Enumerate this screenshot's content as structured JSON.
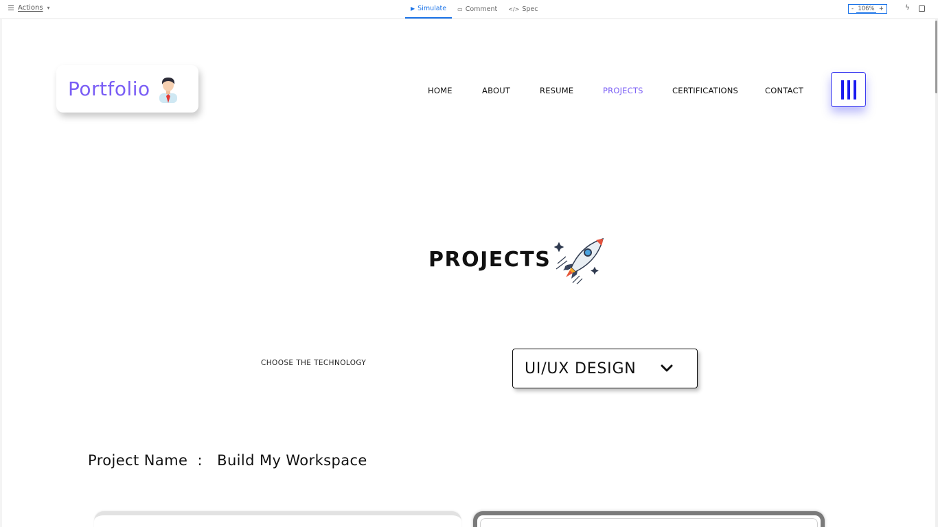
{
  "toolbar": {
    "actions_label": "Actions",
    "tabs": [
      {
        "label": "Simulate",
        "icon": "play-icon",
        "active": true
      },
      {
        "label": "Comment",
        "icon": "comment-icon",
        "active": false
      },
      {
        "label": "Spec",
        "icon": "code-icon",
        "active": false
      }
    ],
    "zoom": {
      "minus": "-",
      "value": "106%",
      "plus": "+"
    },
    "accent_color": "#1a73e8"
  },
  "site": {
    "logo_text": "Portfolio",
    "brand_color": "#7a5ef5",
    "nav": [
      "HOME",
      "ABOUT",
      "RESUME",
      "PROJECTS",
      "CERTIFICATIONS",
      "CONTACT"
    ],
    "active_nav": "PROJECTS",
    "section_title": "PROJECTS",
    "choose_label": "CHOOSE THE TECHNOLOGY",
    "technology_selected": "UI/UX DESIGN",
    "project_label": "Project Name",
    "project_separator": ":",
    "project_name": "Build My Workspace"
  }
}
